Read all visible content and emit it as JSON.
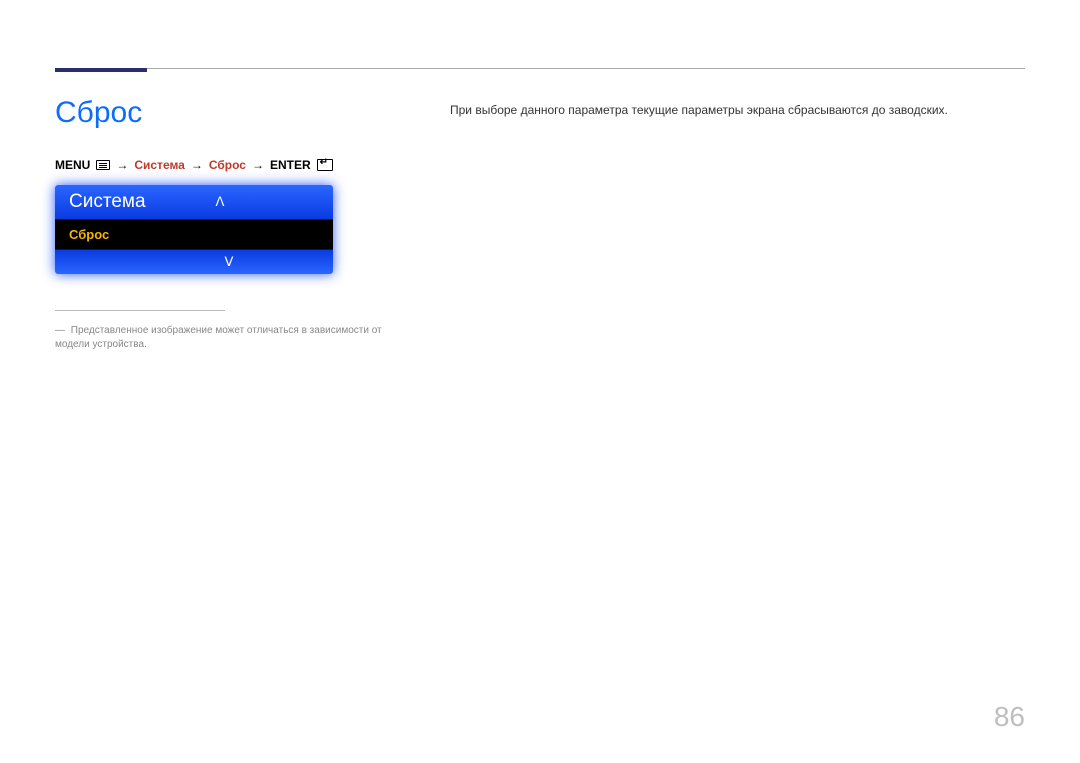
{
  "heading": "Сброс",
  "description": "При выборе данного параметра текущие параметры экрана сбрасываются до заводских.",
  "breadcrumb": {
    "menu": "MENU",
    "sistema": "Система",
    "sbros": "Сброс",
    "enter": "ENTER"
  },
  "osd": {
    "title": "Система",
    "item": "Сброс",
    "chev_up": "ᐱ",
    "chev_down": "ᐯ"
  },
  "footnote": "Представленное изображение может отличаться в зависимости от модели устройства.",
  "dash": "―",
  "arrow": "→",
  "pageNumber": "86"
}
